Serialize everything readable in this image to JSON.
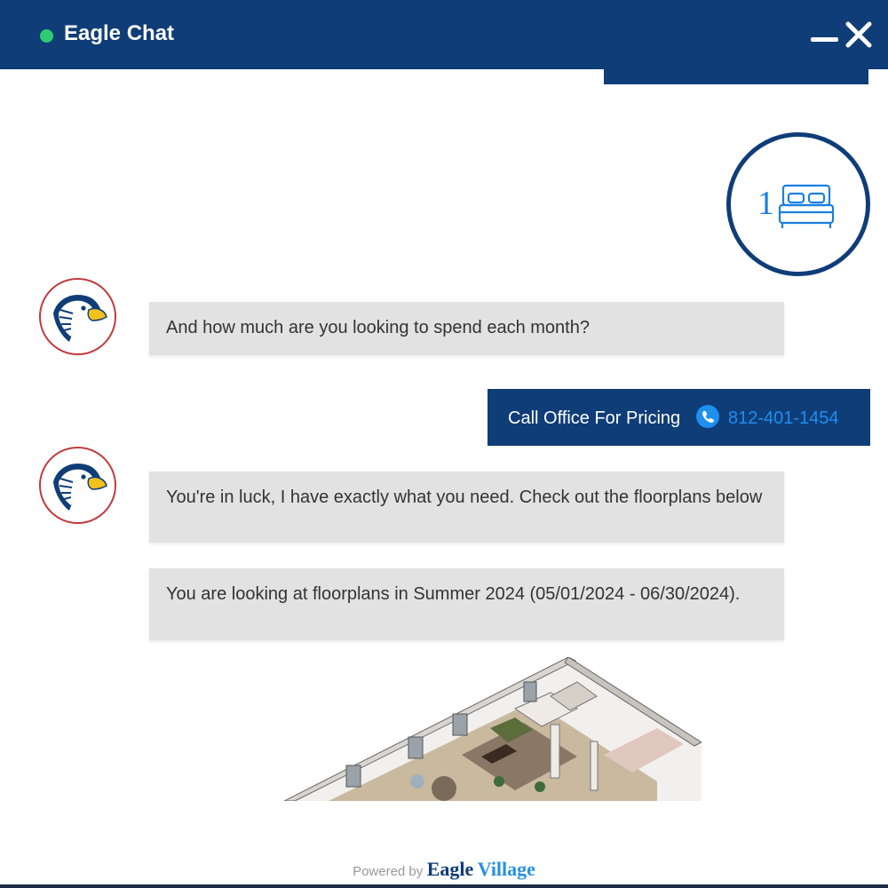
{
  "header": {
    "title": "Eagle Chat",
    "status_color": "#2ecc71",
    "bg_color": "#0f3d78",
    "minimize_icon": "minimize-icon",
    "close_icon": "close-icon"
  },
  "selection": {
    "bedrooms": "1",
    "icon": "bed-icon"
  },
  "messages": [
    {
      "from": "bot",
      "text": "And how much are you looking to spend each month?"
    },
    {
      "from": "user",
      "label": "Call Office For Pricing",
      "phone": "812-401-1454",
      "icon": "phone-icon"
    },
    {
      "from": "bot",
      "text": "You're in luck, I have exactly what you need. Check out the floorplans below"
    },
    {
      "from": "bot",
      "text": "You are looking at floorplans in Summer 2024 (05/01/2024 - 06/30/2024)."
    }
  ],
  "footer": {
    "powered_by": "Powered by",
    "brand_part1": "Eagle",
    "brand_part2": "Village"
  }
}
